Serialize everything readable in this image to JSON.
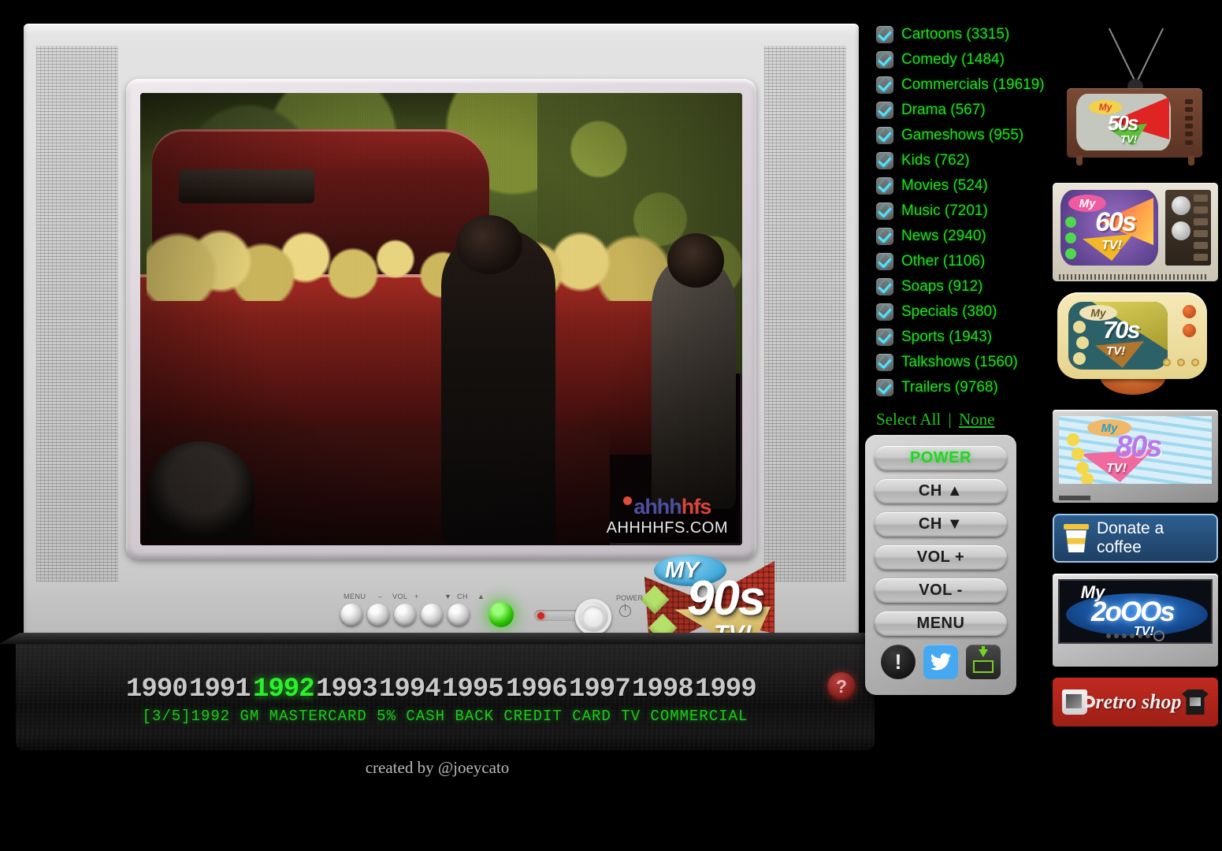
{
  "categories": [
    {
      "label": "Cartoons (3315)",
      "checked": true
    },
    {
      "label": "Comedy (1484)",
      "checked": true
    },
    {
      "label": "Commercials (19619)",
      "checked": true
    },
    {
      "label": "Drama (567)",
      "checked": true
    },
    {
      "label": "Gameshows (955)",
      "checked": true
    },
    {
      "label": "Kids (762)",
      "checked": true
    },
    {
      "label": "Movies (524)",
      "checked": true
    },
    {
      "label": "Music (7201)",
      "checked": true
    },
    {
      "label": "News (2940)",
      "checked": true
    },
    {
      "label": "Other (1106)",
      "checked": true
    },
    {
      "label": "Soaps (912)",
      "checked": true
    },
    {
      "label": "Specials (380)",
      "checked": true
    },
    {
      "label": "Sports (1943)",
      "checked": true
    },
    {
      "label": "Talkshows (1560)",
      "checked": true
    },
    {
      "label": "Trailers (9768)",
      "checked": true
    }
  ],
  "select_row": {
    "select_all": "Select All",
    "separator": "|",
    "none": "None"
  },
  "remote": {
    "power": "POWER",
    "ch_up": "CH ▲",
    "ch_down": "CH ▼",
    "vol_up": "VOL +",
    "vol_down": "VOL -",
    "menu": "MENU",
    "social": {
      "alert": "alert-icon",
      "twitter": "twitter-icon",
      "archive": "archive-download-icon"
    }
  },
  "timeline": {
    "years": [
      "1990",
      "1991",
      "1992",
      "1993",
      "1994",
      "1995",
      "1996",
      "1997",
      "1998",
      "1999"
    ],
    "active_year": "1992",
    "ticker": "[3/5]1992 GM MASTERCARD 5% CASH BACK CREDIT CARD TV COMMERCIAL",
    "help_label": "?"
  },
  "credit": "created by @joeycato",
  "tv": {
    "controls": {
      "menu": "MENU",
      "vol_minus": "–",
      "vol_label": "VOL",
      "vol_plus": "+",
      "ch_down": "▼",
      "ch_label": "CH",
      "ch_up": "▲",
      "power": "POWER"
    },
    "logo": {
      "my": "MY",
      "decade": "90s",
      "tv": "TV!"
    },
    "watermark": {
      "logo_a": "ahhh",
      "logo_b": "hfs",
      "url": "AHHHHFS.COM"
    }
  },
  "sidebar": {
    "tv50": {
      "my": "My",
      "decade": "50s",
      "tv": "TV!"
    },
    "tv60": {
      "my": "My",
      "decade": "60s",
      "tv": "TV!"
    },
    "tv70": {
      "my": "My",
      "decade": "70s",
      "tv": "TV!"
    },
    "tv80": {
      "my": "My",
      "decade": "80s",
      "tv": "TV!"
    },
    "donate": "Donate a coffee",
    "tv2000": {
      "my": "My",
      "decade": "2oOOs",
      "tv": "TV!"
    },
    "shop": "retro shop"
  },
  "colors": {
    "green_text": "#26d926",
    "active_year": "#2bf02b",
    "checkbox_check": "#4fe3ff",
    "twitter_blue": "#46a8f0",
    "donate_blue": "#2d5f91",
    "shop_red": "#c02a20",
    "help_red": "#b8403c"
  }
}
